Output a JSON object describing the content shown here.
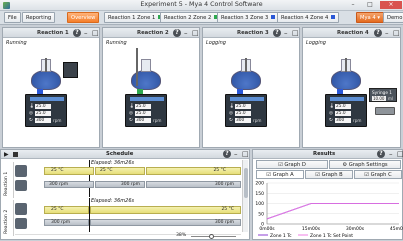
{
  "window": {
    "title": "Experiment 5 - Mya 4 Control Software",
    "minimize": "–",
    "maximize": "□",
    "close": "×"
  },
  "tabs": [
    {
      "label": "File"
    },
    {
      "label": "Reporting"
    },
    {
      "label": "Overview"
    },
    {
      "label": "Reaction 1 Zone 1",
      "color": "#2fa84f"
    },
    {
      "label": "Reaction 2 Zone 2",
      "color": "#2fa84f"
    },
    {
      "label": "Reaction 3 Zone 3",
      "color": "#2b58d6"
    },
    {
      "label": "Reaction 4 Zone 4",
      "color": "#2b58d6"
    },
    {
      "label": "Mya 4"
    },
    {
      "label": "Demo"
    }
  ],
  "reactions": [
    {
      "title": "Reaction 1",
      "state": "Running",
      "temp": "25.0",
      "setpoint": "25.0",
      "rpm": "300",
      "unit": "rpm",
      "indicator": "#2b58d6"
    },
    {
      "title": "Reaction 2",
      "state": "Running",
      "temp": "25.0",
      "setpoint": "25.0",
      "rpm": "300",
      "unit": "rpm",
      "indicator": "#2fa84f"
    },
    {
      "title": "Reaction 3",
      "state": "Logging",
      "temp": "25.0",
      "setpoint": "25.0",
      "rpm": "300",
      "unit": "rpm",
      "indicator": "#2b58d6"
    },
    {
      "title": "Reaction 4",
      "state": "Logging",
      "temp": "25.0",
      "setpoint": "25.0",
      "rpm": "300",
      "unit": "rpm",
      "indicator": "#2b58d6",
      "syringe": "Syringe 1",
      "syringe_vol": "10.00",
      "syringe_unit": "ml"
    }
  ],
  "schedule": {
    "title": "Schedule",
    "zoom": "38%",
    "rows": [
      {
        "label": "Reaction 1",
        "elapsed": "Elapsed: 36m26s",
        "steps": [
          "25 °C",
          "25 °C",
          "25 °C"
        ],
        "stir": [
          "300 rpm",
          "300 rpm",
          "300 rpm"
        ]
      },
      {
        "label": "Reaction 2",
        "elapsed": "Elapsed: 36m26s",
        "steps": [
          "25 °C",
          "25 °C"
        ],
        "stir": [
          "300 rpm",
          "300 rpm"
        ]
      }
    ]
  },
  "results": {
    "title": "Results",
    "top_tabs": [
      "Graph D",
      "Graph Settings"
    ],
    "tabs": [
      "Graph A",
      "Graph B",
      "Graph C"
    ],
    "legend": [
      "Zone 1 Tc",
      "Zone 1 Tc Set Point"
    ]
  },
  "chart_data": {
    "type": "line",
    "x": [
      "0m00s",
      "15m00s",
      "30m00s",
      "45m00s"
    ],
    "yticks": [
      200,
      150,
      100,
      50,
      0
    ],
    "ylim": [
      0,
      200
    ],
    "series": [
      {
        "name": "Zone 1 Tc",
        "values": [
          25,
          100,
          100,
          100
        ]
      },
      {
        "name": "Zone 1 Tc Set Point",
        "values": [
          25,
          100,
          100,
          100
        ]
      }
    ]
  }
}
